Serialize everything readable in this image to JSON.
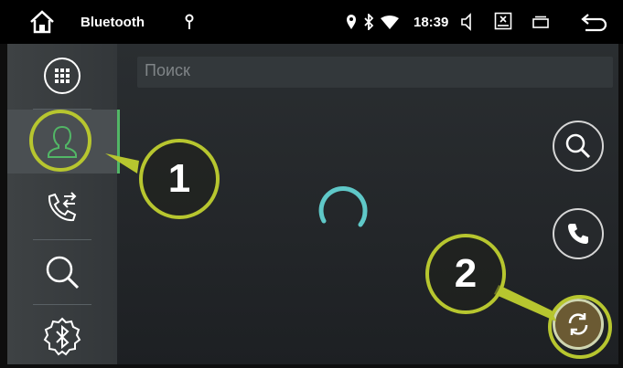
{
  "status_bar": {
    "app_title": "Bluetooth",
    "time": "18:39",
    "icons": [
      "home-icon",
      "usb-icon",
      "location-icon",
      "bluetooth-icon",
      "wifi-icon",
      "volume-icon",
      "screenshot-icon",
      "recent-apps-icon",
      "back-icon"
    ]
  },
  "sidebar": {
    "items": [
      {
        "name": "apps-grid",
        "icon": "apps-grid-icon",
        "active": false
      },
      {
        "name": "contacts",
        "icon": "contact-icon",
        "active": true
      },
      {
        "name": "call-log",
        "icon": "call-transfer-icon",
        "active": false
      },
      {
        "name": "search",
        "icon": "search-icon",
        "active": false
      },
      {
        "name": "bluetooth-settings",
        "icon": "bluetooth-settings-icon",
        "active": false
      }
    ]
  },
  "main": {
    "search_placeholder": "Поиск",
    "loading": true,
    "actions": [
      {
        "name": "search",
        "icon": "search-icon"
      },
      {
        "name": "call",
        "icon": "phone-icon"
      },
      {
        "name": "sync",
        "icon": "sync-icon",
        "highlighted": true
      }
    ]
  },
  "annotations": [
    {
      "label": "1",
      "target": "contacts"
    },
    {
      "label": "2",
      "target": "sync"
    }
  ],
  "colors": {
    "accent_green": "#52b766",
    "callout_yellow": "#b7c62f",
    "spinner": "#5fc8c8",
    "sync_fill": "#6b5a33"
  }
}
